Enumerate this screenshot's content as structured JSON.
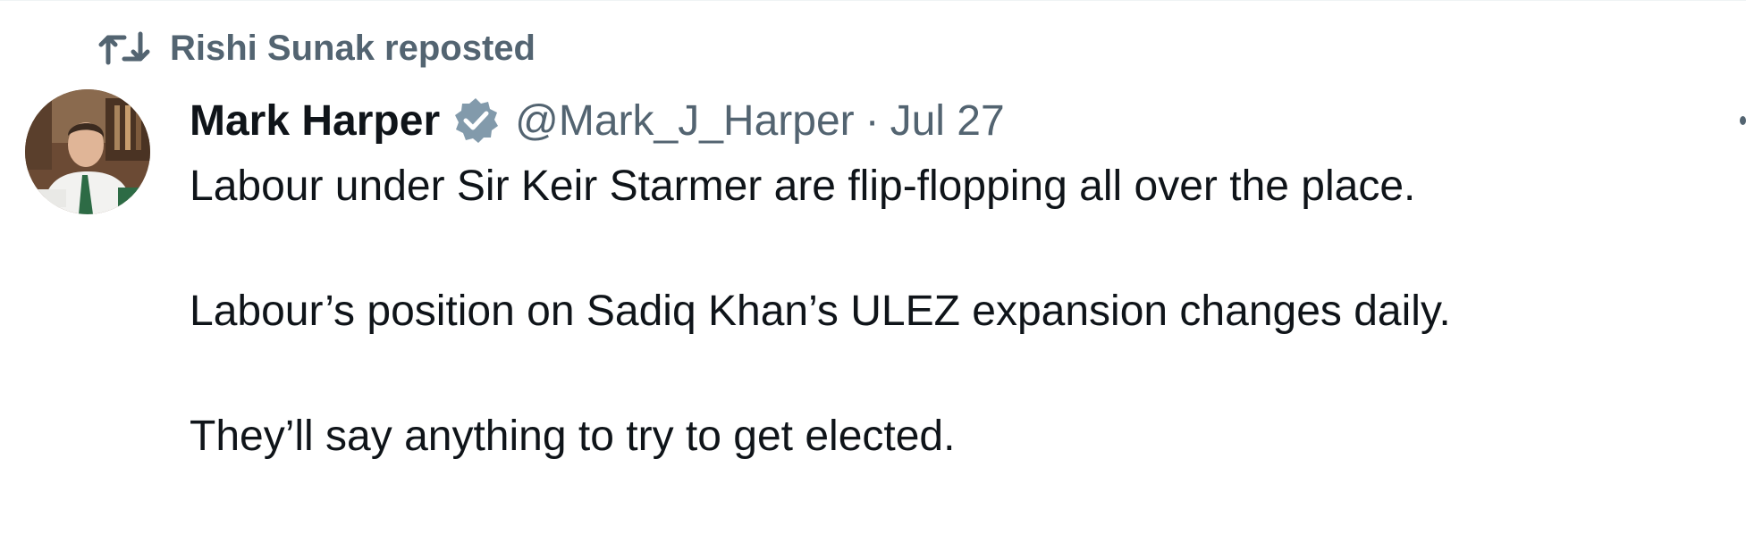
{
  "repost": {
    "label": "Rishi Sunak reposted",
    "icon": "repost-icon"
  },
  "author": {
    "display_name": "Mark Harper",
    "handle": "@Mark_J_Harper",
    "separator": "·",
    "date": "Jul 27",
    "verified": true,
    "avatar_icon": "avatar"
  },
  "tweet": {
    "paragraphs": [
      "Labour under Sir Keir Starmer are flip-flopping all over the place.",
      "Labour’s position on Sadiq Khan’s ULEZ expansion changes daily.",
      "They’ll say anything to try to get elected."
    ]
  },
  "colors": {
    "primary_text": "#0f1419",
    "secondary_text": "#536471",
    "verified_badge": "#829aab"
  }
}
